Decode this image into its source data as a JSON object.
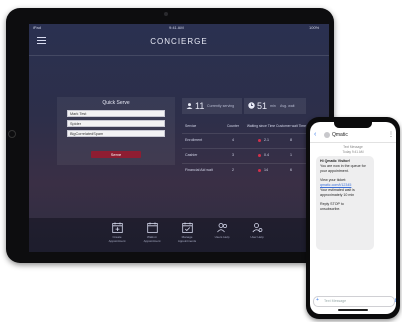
{
  "app": {
    "title": "CONCIERGE"
  },
  "tablet_status": {
    "left": "iPad",
    "center": "9:41 AM",
    "right": "100%"
  },
  "quick_serve": {
    "title": "Quick Serve",
    "fields": [
      "Mark Test",
      "Spider",
      "BigCorrelatedSpam"
    ],
    "button_label": "Serve"
  },
  "stats": [
    {
      "value": "11",
      "label": "Currently serving",
      "icon": "users-icon"
    },
    {
      "value": "51",
      "unit": "min",
      "label": "Avg. wait",
      "icon": "clock-icon"
    }
  ],
  "table": {
    "columns": [
      "Service",
      "Counter",
      "Waiting since Time",
      "Customer wait Time"
    ],
    "rows": [
      {
        "name": "Enrollment",
        "counter": "4",
        "wait": "2.1",
        "avg": "8"
      },
      {
        "name": "Cashier",
        "counter": "3",
        "wait": "0.4",
        "avg": "1"
      },
      {
        "name": "Financial Aid wait",
        "counter": "2",
        "wait": "14",
        "avg": "6"
      }
    ]
  },
  "dock": [
    {
      "label": "Create Appointment",
      "icon": "calendar-add-icon"
    },
    {
      "label": "Walk-in Appointment",
      "icon": "calendar-icon"
    },
    {
      "label": "Manage Appointments",
      "icon": "calendar-check-icon"
    },
    {
      "label": "Users Help",
      "icon": "users-icon"
    },
    {
      "label": "User Help",
      "icon": "user-gear-icon"
    }
  ],
  "phone": {
    "contact": "Qmatic",
    "timestamp_line1": "Text Message",
    "timestamp_line2": "Today 9:41 AM",
    "message_lines": [
      "Hi Qmatic Visitor!",
      "You are now in the queue for",
      "your appointment.",
      "",
      "View your ticket:",
      "qmatic.com/t/12345",
      "Your estimated wait is",
      "approximately 10 min",
      "",
      "Reply STOP to",
      "unsubscribe."
    ],
    "compose_placeholder": "Text Message"
  },
  "colors": {
    "accent": "#8e1d32",
    "alert_dot": "#d3304a",
    "link": "#3b6fd8"
  }
}
